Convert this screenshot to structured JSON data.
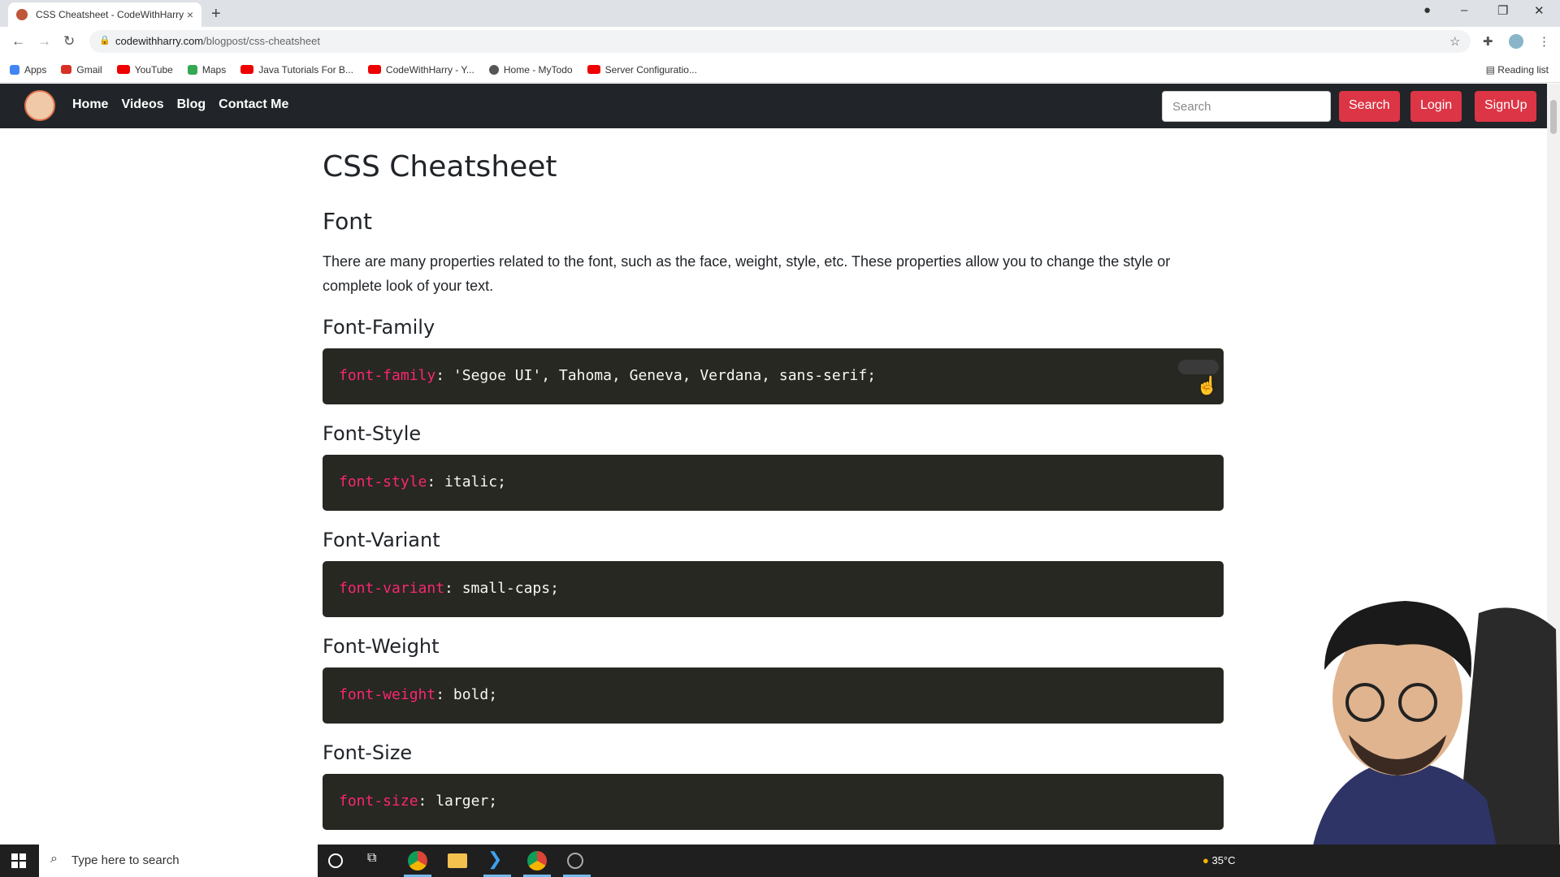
{
  "browser": {
    "tab_title": "CSS Cheatsheet - CodeWithHarry",
    "tab_close": "×",
    "new_tab": "+",
    "url_host": "codewithharry.com",
    "url_path": "/blogpost/css-cheatsheet",
    "bookmarks": [
      "Apps",
      "Gmail",
      "YouTube",
      "Maps",
      "Java Tutorials For B...",
      "CodeWithHarry - Y...",
      "Home - MyTodo",
      "Server Configuratio..."
    ],
    "reading_list": "Reading list"
  },
  "site": {
    "nav": [
      "Home",
      "Videos",
      "Blog",
      "Contact Me"
    ],
    "search_placeholder": "Search",
    "search_button": "Search",
    "login_button": "Login",
    "signup_button": "SignUp"
  },
  "article": {
    "title": "CSS Cheatsheet",
    "section": "Font",
    "intro": "There are many properties related to the font, such as the face, weight, style, etc. These properties allow you to change the style or complete look of your text.",
    "items": [
      {
        "heading": "Font-Family",
        "prop": "font-family",
        "value": ": 'Segoe UI', Tahoma, Geneva, Verdana, sans-serif;"
      },
      {
        "heading": "Font-Style",
        "prop": "font-style",
        "value": ": italic;"
      },
      {
        "heading": "Font-Variant",
        "prop": "font-variant",
        "value": ": small-caps;"
      },
      {
        "heading": "Font-Weight",
        "prop": "font-weight",
        "value": ": bold;"
      },
      {
        "heading": "Font-Size",
        "prop": "font-size",
        "value": ": larger;"
      }
    ]
  },
  "taskbar": {
    "search_placeholder": "Type here to search",
    "temperature": "35°C"
  },
  "colors": {
    "navbar": "#212529",
    "accent_red": "#dc3545",
    "code_bg": "#272822",
    "code_prop": "#f92672"
  }
}
